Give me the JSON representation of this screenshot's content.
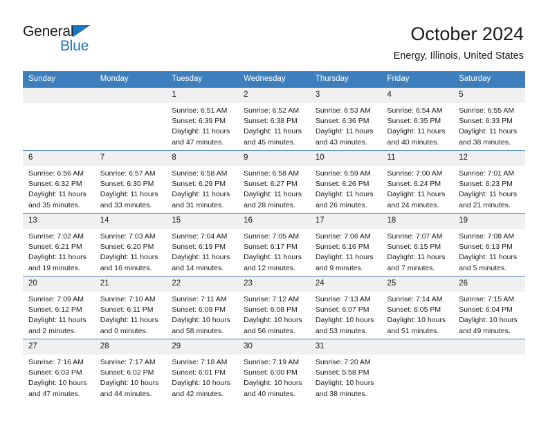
{
  "brand": {
    "name_top": "General",
    "name_bottom": "Blue",
    "accent_color": "#1b75bc"
  },
  "header": {
    "title": "October 2024",
    "subtitle": "Energy, Illinois, United States"
  },
  "calendar": {
    "header_background": "#3d7ebd",
    "daynum_background": "#f0f0f0",
    "weekday_labels": [
      "Sunday",
      "Monday",
      "Tuesday",
      "Wednesday",
      "Thursday",
      "Friday",
      "Saturday"
    ],
    "weeks": [
      [
        {
          "day": "",
          "lines": []
        },
        {
          "day": "",
          "lines": []
        },
        {
          "day": "1",
          "lines": [
            "Sunrise: 6:51 AM",
            "Sunset: 6:39 PM",
            "Daylight: 11 hours",
            "and 47 minutes."
          ]
        },
        {
          "day": "2",
          "lines": [
            "Sunrise: 6:52 AM",
            "Sunset: 6:38 PM",
            "Daylight: 11 hours",
            "and 45 minutes."
          ]
        },
        {
          "day": "3",
          "lines": [
            "Sunrise: 6:53 AM",
            "Sunset: 6:36 PM",
            "Daylight: 11 hours",
            "and 43 minutes."
          ]
        },
        {
          "day": "4",
          "lines": [
            "Sunrise: 6:54 AM",
            "Sunset: 6:35 PM",
            "Daylight: 11 hours",
            "and 40 minutes."
          ]
        },
        {
          "day": "5",
          "lines": [
            "Sunrise: 6:55 AM",
            "Sunset: 6:33 PM",
            "Daylight: 11 hours",
            "and 38 minutes."
          ]
        }
      ],
      [
        {
          "day": "6",
          "lines": [
            "Sunrise: 6:56 AM",
            "Sunset: 6:32 PM",
            "Daylight: 11 hours",
            "and 35 minutes."
          ]
        },
        {
          "day": "7",
          "lines": [
            "Sunrise: 6:57 AM",
            "Sunset: 6:30 PM",
            "Daylight: 11 hours",
            "and 33 minutes."
          ]
        },
        {
          "day": "8",
          "lines": [
            "Sunrise: 6:58 AM",
            "Sunset: 6:29 PM",
            "Daylight: 11 hours",
            "and 31 minutes."
          ]
        },
        {
          "day": "9",
          "lines": [
            "Sunrise: 6:58 AM",
            "Sunset: 6:27 PM",
            "Daylight: 11 hours",
            "and 28 minutes."
          ]
        },
        {
          "day": "10",
          "lines": [
            "Sunrise: 6:59 AM",
            "Sunset: 6:26 PM",
            "Daylight: 11 hours",
            "and 26 minutes."
          ]
        },
        {
          "day": "11",
          "lines": [
            "Sunrise: 7:00 AM",
            "Sunset: 6:24 PM",
            "Daylight: 11 hours",
            "and 24 minutes."
          ]
        },
        {
          "day": "12",
          "lines": [
            "Sunrise: 7:01 AM",
            "Sunset: 6:23 PM",
            "Daylight: 11 hours",
            "and 21 minutes."
          ]
        }
      ],
      [
        {
          "day": "13",
          "lines": [
            "Sunrise: 7:02 AM",
            "Sunset: 6:21 PM",
            "Daylight: 11 hours",
            "and 19 minutes."
          ]
        },
        {
          "day": "14",
          "lines": [
            "Sunrise: 7:03 AM",
            "Sunset: 6:20 PM",
            "Daylight: 11 hours",
            "and 16 minutes."
          ]
        },
        {
          "day": "15",
          "lines": [
            "Sunrise: 7:04 AM",
            "Sunset: 6:19 PM",
            "Daylight: 11 hours",
            "and 14 minutes."
          ]
        },
        {
          "day": "16",
          "lines": [
            "Sunrise: 7:05 AM",
            "Sunset: 6:17 PM",
            "Daylight: 11 hours",
            "and 12 minutes."
          ]
        },
        {
          "day": "17",
          "lines": [
            "Sunrise: 7:06 AM",
            "Sunset: 6:16 PM",
            "Daylight: 11 hours",
            "and 9 minutes."
          ]
        },
        {
          "day": "18",
          "lines": [
            "Sunrise: 7:07 AM",
            "Sunset: 6:15 PM",
            "Daylight: 11 hours",
            "and 7 minutes."
          ]
        },
        {
          "day": "19",
          "lines": [
            "Sunrise: 7:08 AM",
            "Sunset: 6:13 PM",
            "Daylight: 11 hours",
            "and 5 minutes."
          ]
        }
      ],
      [
        {
          "day": "20",
          "lines": [
            "Sunrise: 7:09 AM",
            "Sunset: 6:12 PM",
            "Daylight: 11 hours",
            "and 2 minutes."
          ]
        },
        {
          "day": "21",
          "lines": [
            "Sunrise: 7:10 AM",
            "Sunset: 6:11 PM",
            "Daylight: 11 hours",
            "and 0 minutes."
          ]
        },
        {
          "day": "22",
          "lines": [
            "Sunrise: 7:11 AM",
            "Sunset: 6:09 PM",
            "Daylight: 10 hours",
            "and 58 minutes."
          ]
        },
        {
          "day": "23",
          "lines": [
            "Sunrise: 7:12 AM",
            "Sunset: 6:08 PM",
            "Daylight: 10 hours",
            "and 56 minutes."
          ]
        },
        {
          "day": "24",
          "lines": [
            "Sunrise: 7:13 AM",
            "Sunset: 6:07 PM",
            "Daylight: 10 hours",
            "and 53 minutes."
          ]
        },
        {
          "day": "25",
          "lines": [
            "Sunrise: 7:14 AM",
            "Sunset: 6:05 PM",
            "Daylight: 10 hours",
            "and 51 minutes."
          ]
        },
        {
          "day": "26",
          "lines": [
            "Sunrise: 7:15 AM",
            "Sunset: 6:04 PM",
            "Daylight: 10 hours",
            "and 49 minutes."
          ]
        }
      ],
      [
        {
          "day": "27",
          "lines": [
            "Sunrise: 7:16 AM",
            "Sunset: 6:03 PM",
            "Daylight: 10 hours",
            "and 47 minutes."
          ]
        },
        {
          "day": "28",
          "lines": [
            "Sunrise: 7:17 AM",
            "Sunset: 6:02 PM",
            "Daylight: 10 hours",
            "and 44 minutes."
          ]
        },
        {
          "day": "29",
          "lines": [
            "Sunrise: 7:18 AM",
            "Sunset: 6:01 PM",
            "Daylight: 10 hours",
            "and 42 minutes."
          ]
        },
        {
          "day": "30",
          "lines": [
            "Sunrise: 7:19 AM",
            "Sunset: 6:00 PM",
            "Daylight: 10 hours",
            "and 40 minutes."
          ]
        },
        {
          "day": "31",
          "lines": [
            "Sunrise: 7:20 AM",
            "Sunset: 5:58 PM",
            "Daylight: 10 hours",
            "and 38 minutes."
          ]
        },
        {
          "day": "",
          "lines": []
        },
        {
          "day": "",
          "lines": []
        }
      ]
    ]
  }
}
